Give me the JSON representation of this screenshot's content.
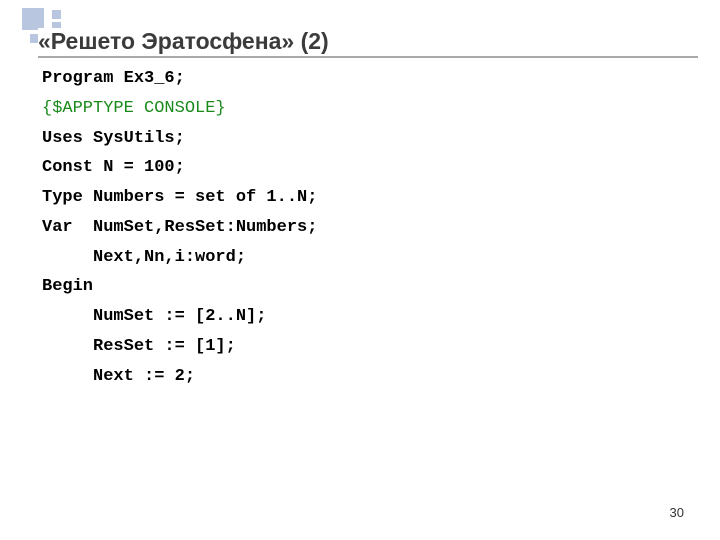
{
  "slide": {
    "title": "«Решето Эратосфена» (2)",
    "page_number": "30"
  },
  "code": {
    "lines": [
      {
        "text": "Program Ex3_6;",
        "style": "normal"
      },
      {
        "text": "{$APPTYPE CONSOLE}",
        "style": "green"
      },
      {
        "text": "Uses SysUtils;",
        "style": "normal"
      },
      {
        "text": "Const N = 100;",
        "style": "normal"
      },
      {
        "text": "Type Numbers = set of 1..N;",
        "style": "normal"
      },
      {
        "text": "Var  NumSet,ResSet:Numbers;",
        "style": "normal"
      },
      {
        "text": "     Next,Nn,i:word;",
        "style": "normal"
      },
      {
        "text": "Begin",
        "style": "normal"
      },
      {
        "text": "     NumSet := [2..N];",
        "style": "normal"
      },
      {
        "text": "     ResSet := [1];",
        "style": "normal"
      },
      {
        "text": "     Next := 2;",
        "style": "normal"
      }
    ]
  }
}
